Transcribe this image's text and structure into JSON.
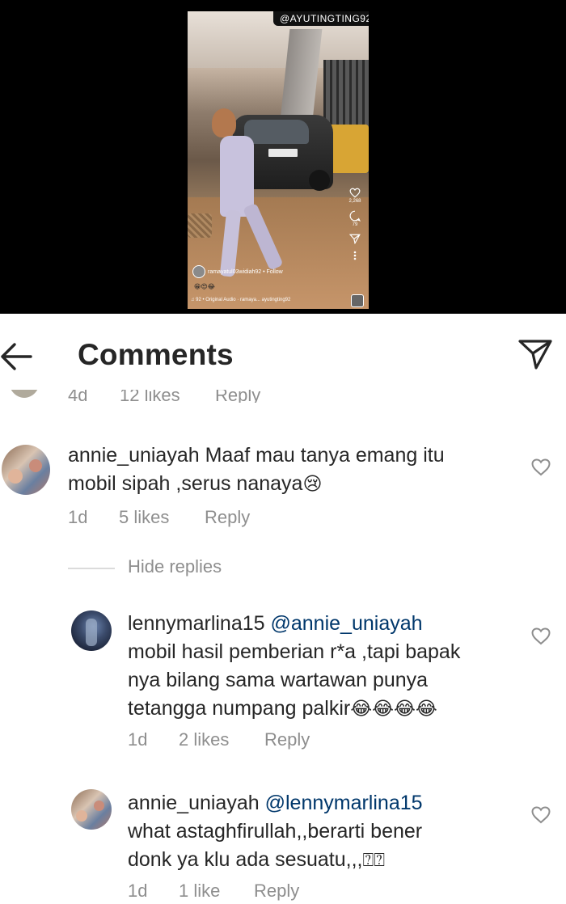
{
  "reel": {
    "watermark": "@AYUTINGTING92",
    "likes_count": "2,268",
    "comments_count": "79",
    "username": "ramayatul03widiah92 • Follow",
    "caption_emojis": "😁😍😂",
    "audio": "♫ 92 • Original Audio · ramaya... ayutingting92"
  },
  "header": {
    "title": "Comments",
    "back_icon": "arrow-left-icon",
    "send_icon": "paper-plane-icon"
  },
  "previous_comment": {
    "time": "4d",
    "likes": "12 likes",
    "reply": "Reply"
  },
  "comments": [
    {
      "username": "annie_uniayah",
      "text_line1": "Maaf mau tanya emang itu",
      "text_line2": "mobil sipah ,serus nanaya",
      "emoji": "😢",
      "time": "1d",
      "likes": "5 likes",
      "reply": "Reply"
    }
  ],
  "replies_toggle": "Hide replies",
  "replies": [
    {
      "username": "lennymarlina15",
      "mention": "@annie_uniayah",
      "text_line1": "mobil hasil pemberian r*a ,tapi bapak",
      "text_line2": "nya bilang sama wartawan punya",
      "text_line3": "tetangga numpang palkir",
      "emoji": "😂😂😂😂",
      "time": "1d",
      "likes": "2 likes",
      "reply": "Reply"
    },
    {
      "username": "annie_uniayah",
      "mention": "@lennymarlina15",
      "text_line1": "what astaghfirullah,,berarti bener",
      "text_line2": "donk ya klu ada sesuatu,,,",
      "emoji": "⍰⍰",
      "time": "1d",
      "likes": "1 like",
      "reply": "Reply"
    }
  ],
  "colors": {
    "text": "#262626",
    "secondary": "#8e8e8e",
    "mention": "#00376b",
    "background": "#ffffff",
    "video_bg": "#000000"
  }
}
